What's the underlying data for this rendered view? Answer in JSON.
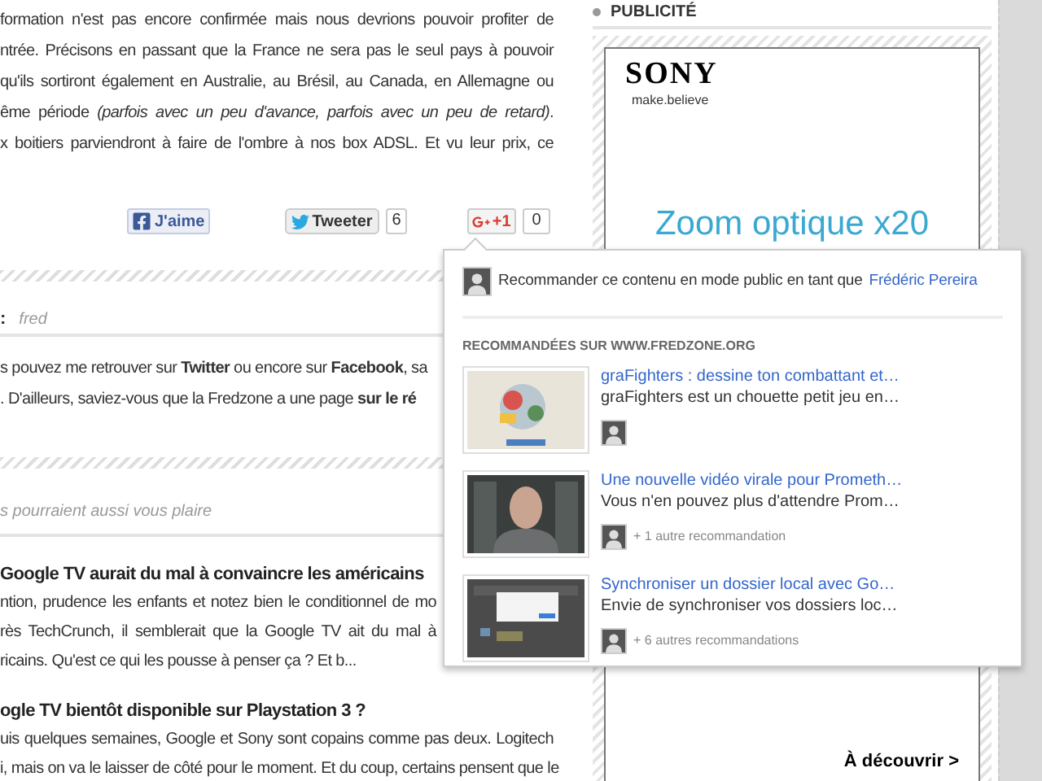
{
  "article": {
    "lines": [
      "formation n'est pas encore confirmée mais nous devrions pouvoir profiter de",
      "ntrée. Précisons en passant que la France ne sera pas le seul pays à pouvoir",
      "qu'ils sortiront également en Australie, au Brésil, au Canada, en Allemagne ou",
      "ême période *(parfois avec un peu d'avance, parfois avec un peu de retard)*.",
      "x boitiers parviendront à faire de l'ombre à nos box ADSL. Et vu leur prix, ce"
    ]
  },
  "share": {
    "facebook": {
      "label": "J'aime"
    },
    "twitter": {
      "label": "Tweeter",
      "count": "6"
    },
    "gplus": {
      "label": "+1",
      "count": "0"
    }
  },
  "author": {
    "label": ":",
    "name": "fred",
    "bio": [
      "s pouvez me retrouver sur **Twitter** ou encore sur **Facebook**, sa",
      ". D'ailleurs, saviez-vous que la Fredzone a une page **sur le ré**"
    ]
  },
  "related": {
    "heading": "s pourraient aussi vous plaire",
    "articles": [
      {
        "title": "Google TV aurait du mal à convaincre les américains",
        "lines": [
          "ntion, prudence les enfants et notez bien le conditionnel de mo",
          "rès TechCrunch, il semblerait que la Google TV ait du mal à",
          "ricains. Qu'est ce qui les pousse à penser ça ? Et b..."
        ]
      },
      {
        "title": "ogle TV bientôt disponible sur Playstation 3 ?",
        "lines": [
          "uis quelques semaines, Google et Sony sont copains comme pas deux. Logitech",
          "i, mais on va le laisser de côté pour le moment. Et du coup, certains pensent que le"
        ]
      }
    ]
  },
  "sidebar": {
    "title": "PUBLICITÉ",
    "ad": {
      "brand": "SONY",
      "tagline": "make.believe",
      "headline": "Zoom optique x20",
      "cta": "À découvrir >"
    }
  },
  "popup": {
    "prompt": "Recommander ce contenu en mode public en tant que",
    "user": "Frédéric Pereira",
    "section": "RECOMMANDÉES SUR WWW.FREDZONE.ORG",
    "items": [
      {
        "kind": "picture",
        "title": "graFighters : dessine ton combattant et…",
        "description": "graFighters est un chouette petit jeu en…"
      },
      {
        "kind": "picture",
        "title": "Une nouvelle vidéo virale pour Prometh…",
        "description": "Vous n'en pouvez plus d'attendre Prom…",
        "recommendations": "+ 1 autre recommandation"
      },
      {
        "kind": "picture",
        "title": "Synchroniser un dossier local avec Go…",
        "description": "Envie de synchroniser vos dossiers loc…",
        "recommendations": "+ 6 autres recommandations"
      }
    ]
  }
}
